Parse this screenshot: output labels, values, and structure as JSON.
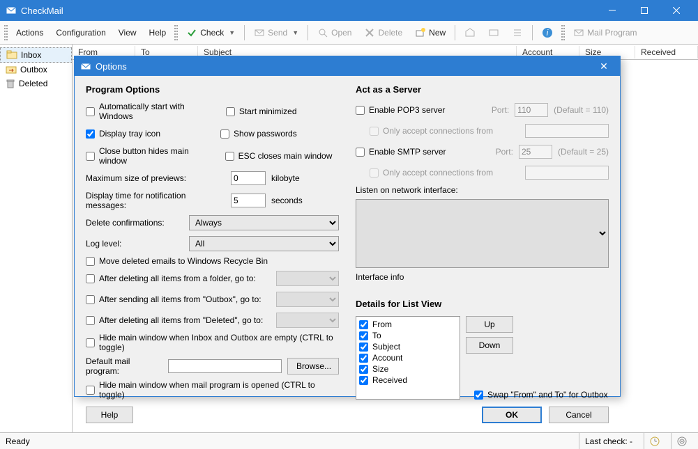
{
  "app": {
    "title": "CheckMail"
  },
  "menu": {
    "actions": "Actions",
    "configuration": "Configuration",
    "view": "View",
    "help": "Help"
  },
  "toolbar": {
    "check": "Check",
    "send": "Send",
    "open": "Open",
    "delete": "Delete",
    "new": "New",
    "mail_program": "Mail Program"
  },
  "sidebar": {
    "items": [
      {
        "label": "Inbox"
      },
      {
        "label": "Outbox"
      },
      {
        "label": "Deleted"
      }
    ]
  },
  "list_columns": {
    "from": "From",
    "to": "To",
    "subject": "Subject",
    "account": "Account",
    "size": "Size",
    "received": "Received"
  },
  "status": {
    "ready": "Ready",
    "last_check": "Last check: -"
  },
  "dialog": {
    "title": "Options",
    "program_options": {
      "heading": "Program Options",
      "auto_start": "Automatically start with Windows",
      "start_min": "Start minimized",
      "tray_icon": "Display tray icon",
      "show_pw": "Show passwords",
      "close_hides": "Close button hides main window",
      "esc_closes": "ESC closes main window",
      "max_preview_label": "Maximum size of previews:",
      "max_preview_value": "0",
      "max_preview_unit": "kilobyte",
      "notif_label": "Display time for notification messages:",
      "notif_value": "5",
      "notif_unit": "seconds",
      "delete_conf_label": "Delete confirmations:",
      "delete_conf_value": "Always",
      "log_level_label": "Log level:",
      "log_level_value": "All",
      "move_recycle": "Move deleted emails to Windows Recycle Bin",
      "after_delete_folder": "After deleting all items from a folder, go to:",
      "after_send_outbox": "After sending all items from \"Outbox\", go to:",
      "after_delete_deleted": "After deleting all items from \"Deleted\", go to:",
      "hide_empty": "Hide main window when Inbox and Outbox are empty (CTRL to toggle)",
      "default_mail_label": "Default mail program:",
      "browse": "Browse...",
      "hide_on_open": "Hide main window when mail program is opened (CTRL to toggle)"
    },
    "server": {
      "heading": "Act as a Server",
      "enable_pop3": "Enable POP3 server",
      "port_label": "Port:",
      "pop3_port": "110",
      "pop3_default": "(Default = 110)",
      "only_accept": "Only accept connections from",
      "enable_smtp": "Enable SMTP server",
      "smtp_port": "25",
      "smtp_default": "(Default = 25)",
      "listen_label": "Listen on network interface:",
      "interface_info": "Interface info"
    },
    "details": {
      "heading": "Details for List View",
      "items": [
        "From",
        "To",
        "Subject",
        "Account",
        "Size",
        "Received"
      ],
      "up": "Up",
      "down": "Down",
      "swap": "Swap \"From\" and To\" for Outbox"
    },
    "buttons": {
      "help": "Help",
      "ok": "OK",
      "cancel": "Cancel"
    }
  }
}
